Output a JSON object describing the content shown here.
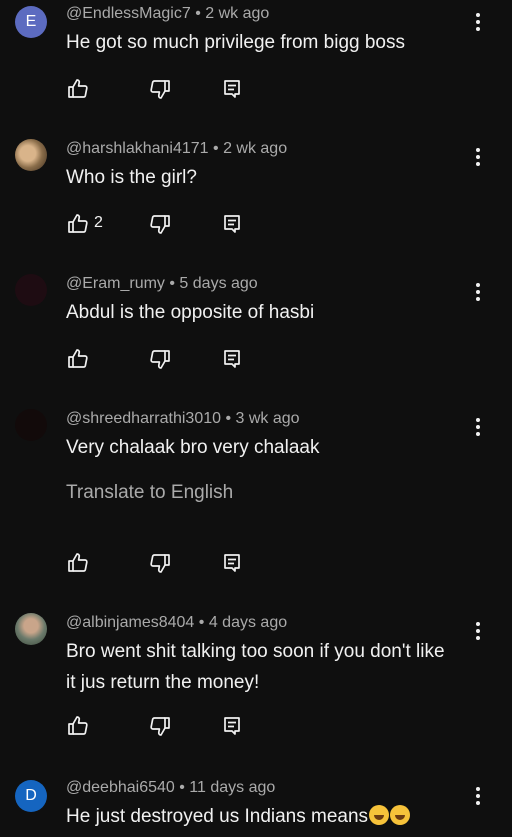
{
  "comments": [
    {
      "avatar_letter": "E",
      "avatar_color": "#5c6bc0",
      "handle": "@EndlessMagic7",
      "time": "2 wk ago",
      "text": "He got so much privilege from bigg boss",
      "likes": ""
    },
    {
      "avatar_letter": "",
      "avatar_color": "#8a6d4a",
      "handle": "@harshlakhani4171",
      "time": "2 wk ago",
      "text": "Who is the girl?",
      "likes": "2"
    },
    {
      "avatar_letter": "",
      "avatar_color": "#1e0c12",
      "handle": "@Eram_rumy",
      "time": "5 days ago",
      "text": "Abdul is the opposite of hasbi",
      "likes": ""
    },
    {
      "avatar_letter": "",
      "avatar_color": "#120a0a",
      "handle": "@shreedharrathi3010",
      "time": "3 wk ago",
      "text": "Very chalaak bro very chalaak",
      "translate": "Translate to English",
      "likes": ""
    },
    {
      "avatar_letter": "",
      "avatar_color": "#6b7a6b",
      "handle": "@albinjames8404",
      "time": "4 days ago",
      "text_line1": "Bro went shit talking too soon if you don't like",
      "text_line2": "it jus return the money!",
      "likes": ""
    },
    {
      "avatar_letter": "D",
      "avatar_color": "#1565c0",
      "handle": "@deebhai6540",
      "time": "11 days ago",
      "text": "He just destroyed us Indians means",
      "likes": ""
    }
  ],
  "separator": " • ",
  "icons": {
    "like": "thumb-up-icon",
    "dislike": "thumb-down-icon",
    "reply": "reply-icon",
    "more": "more-vert-icon"
  }
}
